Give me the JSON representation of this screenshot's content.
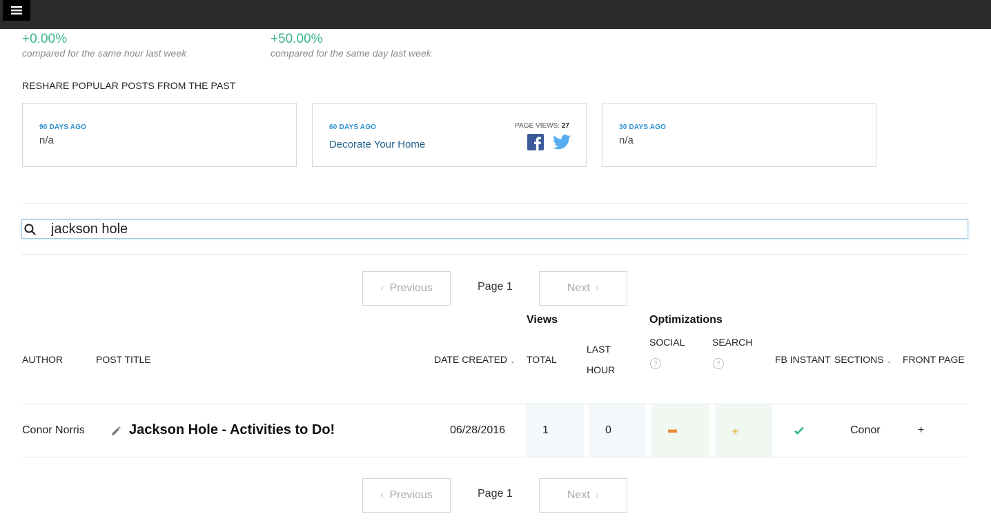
{
  "header": {
    "menu_icon": "hamburger-icon"
  },
  "stats": [
    {
      "pct": "+0.00%",
      "compare": "compared for the same hour last week"
    },
    {
      "pct": "+50.00%",
      "compare": "compared for the same day last week"
    }
  ],
  "reshare": {
    "title": "RESHARE POPULAR POSTS FROM THE PAST",
    "cards": [
      {
        "ago": "90 DAYS AGO",
        "post": "n/a"
      },
      {
        "ago": "60 DAYS AGO",
        "post": "Decorate Your Home",
        "page_views_label": "PAGE VIEWS:",
        "page_views": "27"
      },
      {
        "ago": "30 DAYS AGO",
        "post": "n/a"
      }
    ]
  },
  "search": {
    "value": "jackson hole",
    "icon": "search-icon"
  },
  "pager": {
    "previous": "Previous",
    "page_label": "Page 1",
    "next": "Next"
  },
  "table": {
    "group_views": "Views",
    "group_optimizations": "Optimizations",
    "columns": {
      "author": "AUTHOR",
      "post_title": "POST TITLE",
      "date_created": "DATE CREATED",
      "total": "TOTAL",
      "last_hour_1": "LAST",
      "last_hour_2": "HOUR",
      "social": "SOCIAL",
      "search": "SEARCH",
      "fb_instant": "FB INSTANT",
      "sections": "SECTIONS",
      "front_page": "FRONT PAGE"
    },
    "rows": [
      {
        "author": "Conor Norris",
        "title": "Jackson Hole - Activities to Do!",
        "date": "06/28/2016",
        "total": "1",
        "last_hour": "0",
        "sections": "Conor",
        "front_page": "+"
      }
    ]
  },
  "colors": {
    "accent_green": "#3bb58c",
    "link_blue": "#2a8fd0",
    "facebook": "#3b5a9a",
    "twitter": "#55acee"
  }
}
